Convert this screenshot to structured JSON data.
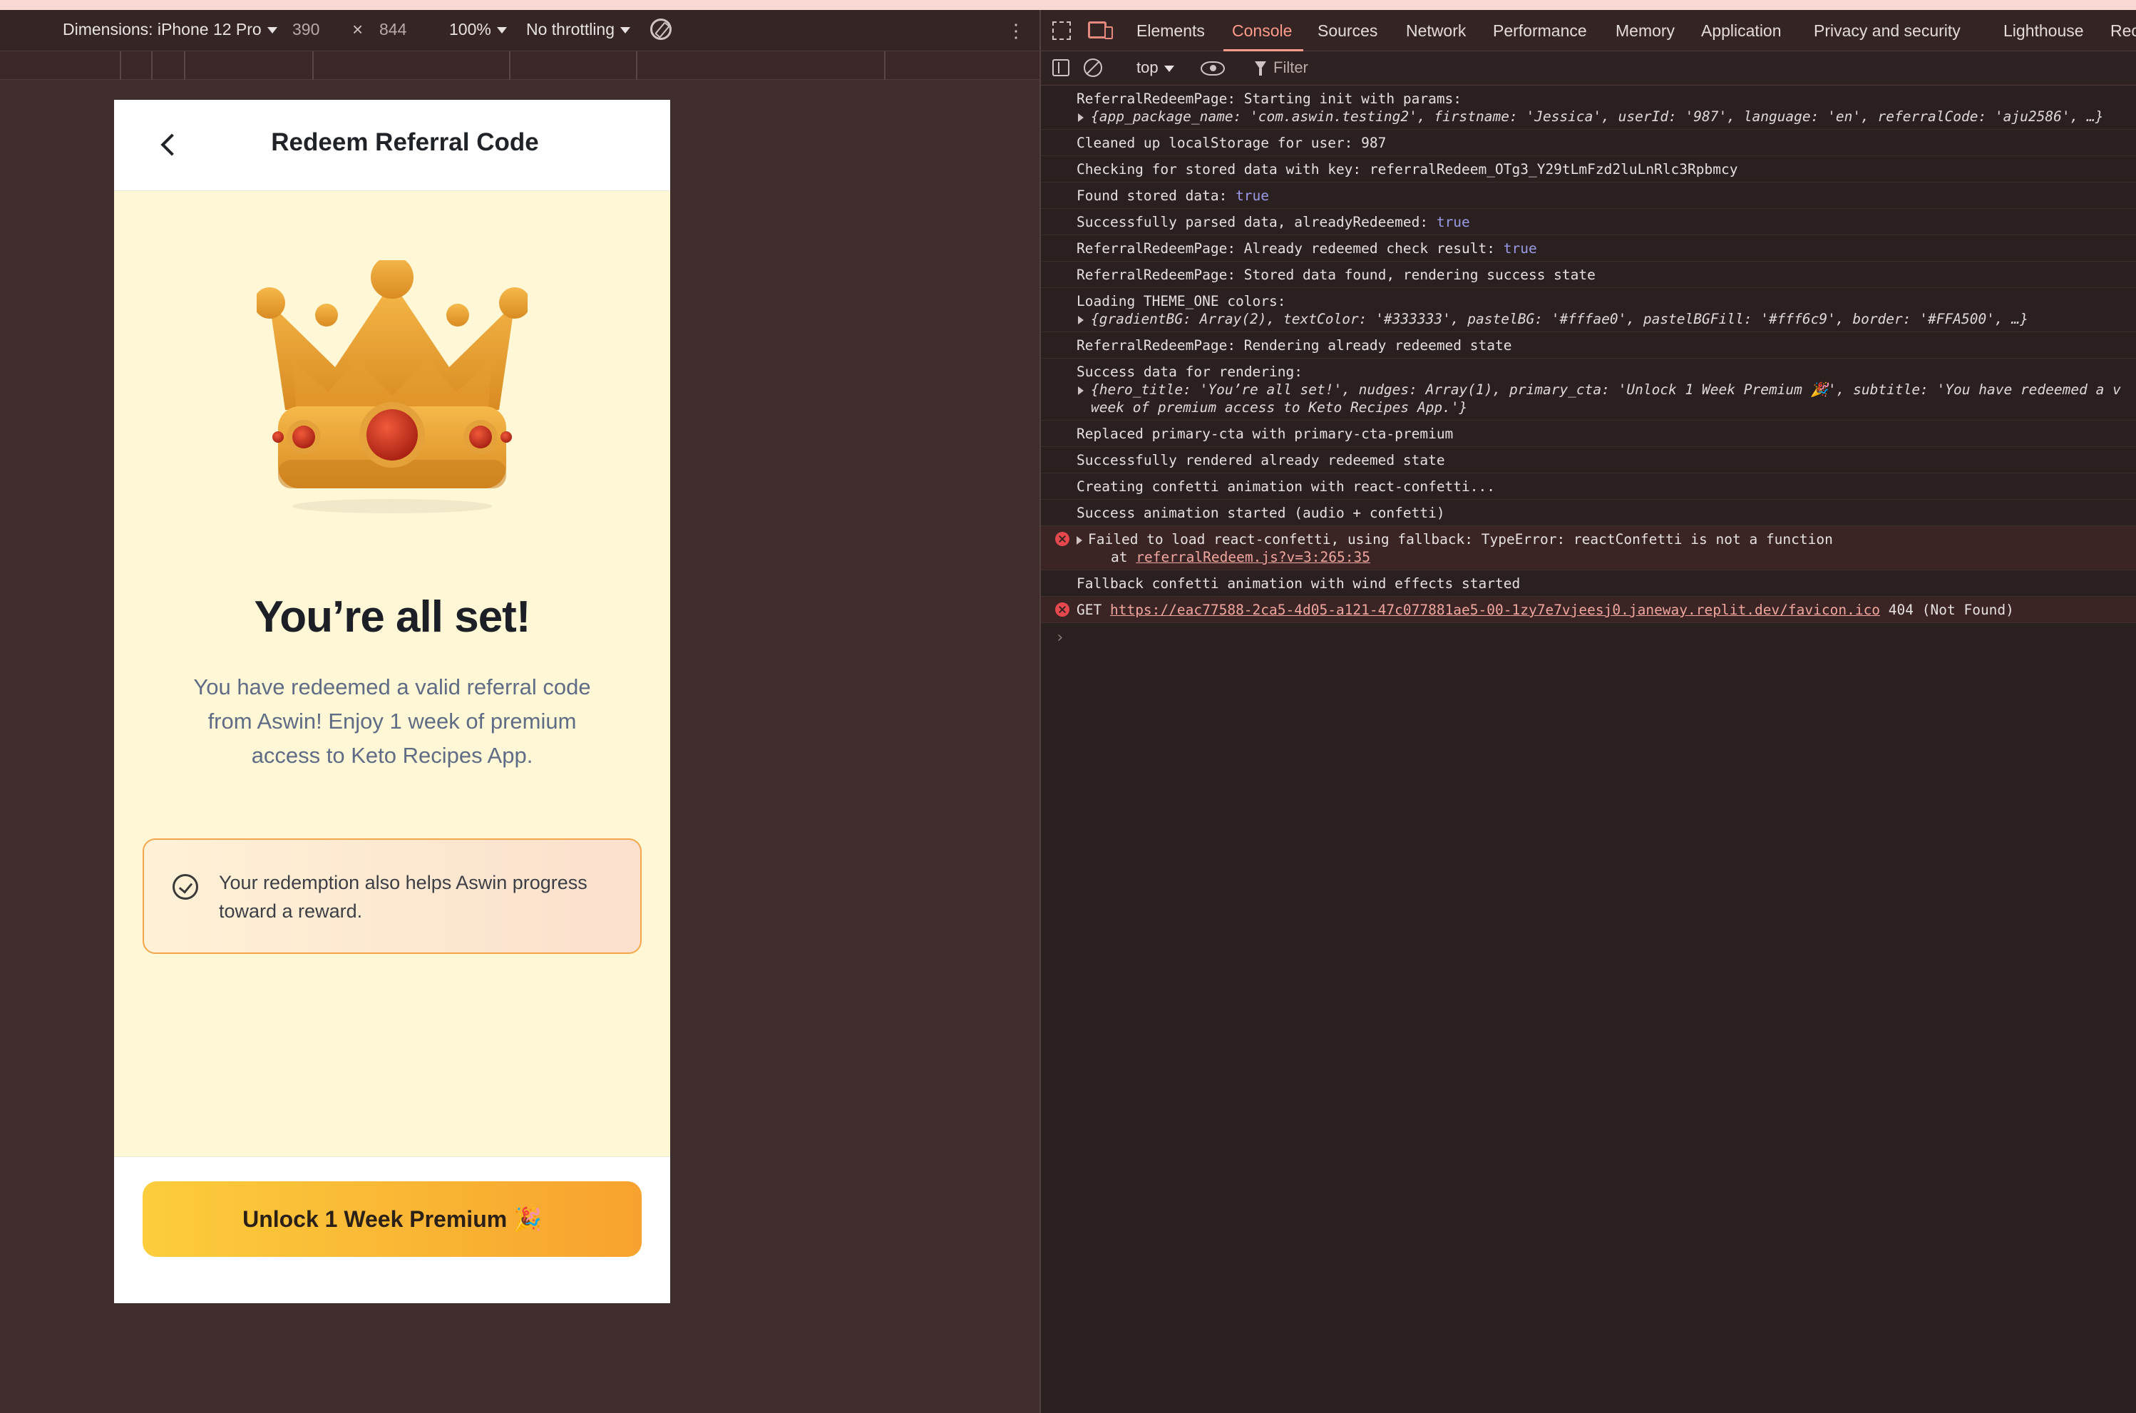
{
  "device_toolbar": {
    "dimensions_label": "Dimensions: iPhone 12 Pro",
    "width": "390",
    "times": "×",
    "height": "844",
    "zoom": "100%",
    "throttling": "No throttling"
  },
  "phone": {
    "header_title": "Redeem Referral Code",
    "hero_title": "You’re all set!",
    "hero_subtitle": "You have redeemed a valid referral code from Aswin! Enjoy 1 week of premium access to Keto Recipes App.",
    "nudge_text": "Your redemption also helps Aswin progress toward a reward.",
    "cta_label": "Unlock 1 Week Premium 🎉"
  },
  "devtools": {
    "tabs": [
      "Elements",
      "Console",
      "Sources",
      "Network",
      "Performance",
      "Memory",
      "Application",
      "Privacy and security",
      "Lighthouse",
      "Rec"
    ],
    "active_tab": "Console",
    "context": "top",
    "filter_placeholder": "Filter"
  },
  "console": {
    "m1": "ReferralRedeemPage: Starting init with params:",
    "m1b": "{app_package_name: 'com.aswin.testing2', firstname: 'Jessica', userId: '987', language: 'en', referralCode: 'aju2586', …}",
    "m2": "Cleaned up localStorage for user: 987",
    "m3": "Checking for stored data with key: referralRedeem_OTg3_Y29tLmFzd2luLnRlc3Rpbmcy",
    "m4": "Found stored data: ",
    "m4v": "true",
    "m5": "Successfully parsed data, alreadyRedeemed: ",
    "m5v": "true",
    "m6": "ReferralRedeemPage: Already redeemed check result: ",
    "m6v": "true",
    "m7": "ReferralRedeemPage: Stored data found, rendering success state",
    "m8": "Loading THEME_ONE colors:",
    "m8b": "{gradientBG: Array(2), textColor: '#333333', pastelBG: '#fffae0', pastelBGFill: '#fff6c9', border: '#FFA500', …}",
    "m9": "ReferralRedeemPage: Rendering already redeemed state",
    "m10": "Success data for rendering:",
    "m10b": "{hero_title: 'You’re all set!', nudges: Array(1), primary_cta: 'Unlock 1 Week Premium 🎉', subtitle: 'You have redeemed a v",
    "m10c": "week of premium access to Keto Recipes App.'}",
    "m11": "Replaced primary-cta with primary-cta-premium",
    "m12": "Successfully rendered already redeemed state",
    "m13": "Creating confetti animation with react-confetti...",
    "m14": "Success animation started (audio + confetti)",
    "e1": "Failed to load react-confetti, using fallback: TypeError: reactConfetti is not a function",
    "e1_at": "at ",
    "e1_link": "referralRedeem.js?v=3:265:35",
    "m15": "Fallback confetti animation with wind effects started",
    "e2_method": "GET ",
    "e2_url": "https://eac77588-2ca5-4d05-a121-47c077881ae5-00-1zy7e7vjeesj0.janeway.replit.dev/favicon.ico",
    "e2_status": " 404 (Not Found)",
    "prompt": "›"
  },
  "colors": {
    "accent": "#ff9b8a",
    "cta_start": "#fccd3c",
    "cta_end": "#f7a22e",
    "page_bg": "#fff7d6",
    "nudge_border": "#f6a54a",
    "error": "#e5484d"
  },
  "icons": [
    "chevron-left-icon",
    "crown-image",
    "check-circle-icon",
    "rotate-icon",
    "inspect-icon",
    "device-toggle-icon",
    "sidebar-icon",
    "clear-console-icon",
    "eye-icon",
    "filter-icon",
    "error-icon"
  ]
}
